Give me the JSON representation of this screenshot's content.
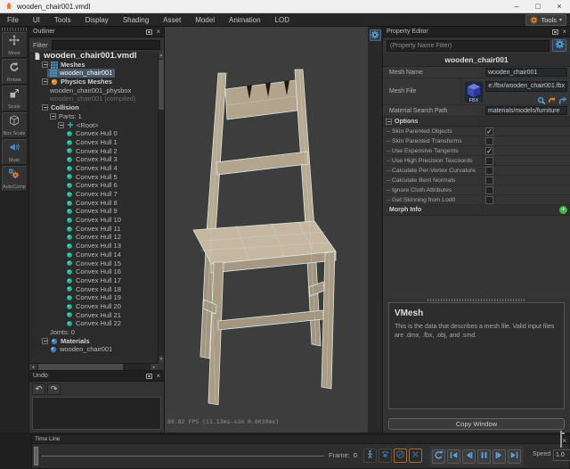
{
  "window": {
    "title": "wooden_chair001.vmdl"
  },
  "menu_bar": {
    "items": [
      "File",
      "UI",
      "Tools",
      "Display",
      "Shading",
      "Asset",
      "Model",
      "Animation",
      "LOD"
    ],
    "tools_button_label": "Tools"
  },
  "left_toolbar": {
    "buttons": [
      {
        "name": "move",
        "label": "Move"
      },
      {
        "name": "rotate",
        "label": "Rotate"
      },
      {
        "name": "scale",
        "label": "Scale"
      },
      {
        "name": "box-scale",
        "label": "Box Scale"
      },
      {
        "name": "mute",
        "label": "Mute"
      },
      {
        "name": "autocomp",
        "label": "AutoComp"
      }
    ]
  },
  "outliner": {
    "title": "Outliner",
    "filter_label": "Filter",
    "tree": [
      {
        "depth": 0,
        "label": "wooden_chair001.vmdl",
        "icon": "doc",
        "large": true
      },
      {
        "depth": 1,
        "label": "Meshes",
        "icon": "mesh",
        "bold": true,
        "expander": true
      },
      {
        "depth": 2,
        "label": "wooden_chair001",
        "icon": "mesh",
        "selected": true
      },
      {
        "depth": 1,
        "label": "Physics Meshes",
        "icon": "physics",
        "bold": true,
        "expander": true
      },
      {
        "depth": 2,
        "label": "wooden_chair001_physbox"
      },
      {
        "depth": 2,
        "label": "wooden_chair001 (compiled)",
        "dim": true
      },
      {
        "depth": 1,
        "label": "Collision",
        "bold": true,
        "expander": true
      },
      {
        "depth": 2,
        "label": "Parts: 1",
        "expander": true
      },
      {
        "depth": 3,
        "label": "<Root>",
        "icon": "root",
        "expander": true
      },
      {
        "depth": 4,
        "label": "Convex Hull 0",
        "icon": "hull"
      },
      {
        "depth": 4,
        "label": "Convex Hull 1",
        "icon": "hull"
      },
      {
        "depth": 4,
        "label": "Convex Hull 2",
        "icon": "hull"
      },
      {
        "depth": 4,
        "label": "Convex Hull 3",
        "icon": "hull"
      },
      {
        "depth": 4,
        "label": "Convex Hull 4",
        "icon": "hull"
      },
      {
        "depth": 4,
        "label": "Convex Hull 5",
        "icon": "hull"
      },
      {
        "depth": 4,
        "label": "Convex Hull 6",
        "icon": "hull"
      },
      {
        "depth": 4,
        "label": "Convex Hull 7",
        "icon": "hull"
      },
      {
        "depth": 4,
        "label": "Convex Hull 8",
        "icon": "hull"
      },
      {
        "depth": 4,
        "label": "Convex Hull 9",
        "icon": "hull"
      },
      {
        "depth": 4,
        "label": "Convex Hull 10",
        "icon": "hull"
      },
      {
        "depth": 4,
        "label": "Convex Hull 11",
        "icon": "hull"
      },
      {
        "depth": 4,
        "label": "Convex Hull 12",
        "icon": "hull"
      },
      {
        "depth": 4,
        "label": "Convex Hull 13",
        "icon": "hull"
      },
      {
        "depth": 4,
        "label": "Convex Hull 14",
        "icon": "hull"
      },
      {
        "depth": 4,
        "label": "Convex Hull 15",
        "icon": "hull"
      },
      {
        "depth": 4,
        "label": "Convex Hull 16",
        "icon": "hull"
      },
      {
        "depth": 4,
        "label": "Convex Hull 17",
        "icon": "hull"
      },
      {
        "depth": 4,
        "label": "Convex Hull 18",
        "icon": "hull"
      },
      {
        "depth": 4,
        "label": "Convex Hull 19",
        "icon": "hull"
      },
      {
        "depth": 4,
        "label": "Convex Hull 20",
        "icon": "hull"
      },
      {
        "depth": 4,
        "label": "Convex Hull 21",
        "icon": "hull"
      },
      {
        "depth": 4,
        "label": "Convex Hull 22",
        "icon": "hull"
      },
      {
        "depth": 2,
        "label": "Joints: 0"
      },
      {
        "depth": 1,
        "label": "Materials",
        "icon": "material",
        "bold": true,
        "expander": true
      },
      {
        "depth": 2,
        "label": "wooden_chair001",
        "icon": "material"
      }
    ]
  },
  "viewport": {
    "stats_text": "89.82 FPS (11.13ms-sim 0.0030ms)"
  },
  "undo_panel": {
    "title": "Undo"
  },
  "property_editor": {
    "title": "Property Editor",
    "filter_placeholder": "(Property Name Filter)",
    "object_title": "wooden_chair001",
    "rows": [
      {
        "label": "Mesh Name",
        "value": "wooden_chair001",
        "type": "text"
      },
      {
        "label": "Mesh File",
        "value": "e:/fbx/wooden_chair001.fbx",
        "type": "file"
      },
      {
        "label": "Material Search Path",
        "value": "materials/models/furniture",
        "type": "text"
      }
    ],
    "options_header": "Options",
    "options": [
      {
        "label": "Skin Parented Objects",
        "checked": true
      },
      {
        "label": "Skin Parented Transforms",
        "checked": false
      },
      {
        "label": "Use Expensive Tangents",
        "checked": true
      },
      {
        "label": "Use High Precision Texcoords",
        "checked": false
      },
      {
        "label": "Calculate Per-Vertex Curvature",
        "checked": false
      },
      {
        "label": "Calculate Bent Normals",
        "checked": false
      },
      {
        "label": "Ignore Cloth Attributes",
        "checked": false
      },
      {
        "label": "Get Skinning from Lod0",
        "checked": false
      }
    ],
    "morph_info_label": "Morph Info",
    "vmesh_title": "VMesh",
    "vmesh_description": "This is the data that describes a mesh file. Valid input files are .dmx, .fbx, .obj, and .smd.",
    "copy_window_label": "Copy Window"
  },
  "timeline": {
    "title": "Time Line",
    "frame_label": "Frame:",
    "frame_value": "0",
    "speed_label": "Speed",
    "speed_value": "1.0",
    "toggle_buttons": [
      {
        "name": "person-toggle",
        "icon": "person",
        "active": false
      },
      {
        "name": "paw-toggle",
        "icon": "paw",
        "active": false
      },
      {
        "name": "slash-toggle",
        "icon": "slash",
        "active": true
      },
      {
        "name": "cross-toggle",
        "icon": "cross",
        "active": true
      }
    ],
    "playback_buttons": [
      {
        "name": "loop-button",
        "icon": "loop"
      },
      {
        "name": "skip-start-button",
        "icon": "skip-start"
      },
      {
        "name": "step-back-button",
        "icon": "step-back"
      },
      {
        "name": "pause-button",
        "icon": "pause"
      },
      {
        "name": "step-forward-button",
        "icon": "step-forward"
      },
      {
        "name": "skip-end-button",
        "icon": "skip-end"
      }
    ]
  },
  "colors": {
    "accent_blue": "#4a90c4",
    "accent_orange": "#e8882a",
    "hull_teal": "#23b89c",
    "selection": "#4a5868",
    "viewport_bg": "#3d3d3d",
    "wood": "#b3a48e",
    "wire": "#d9e8e2"
  }
}
